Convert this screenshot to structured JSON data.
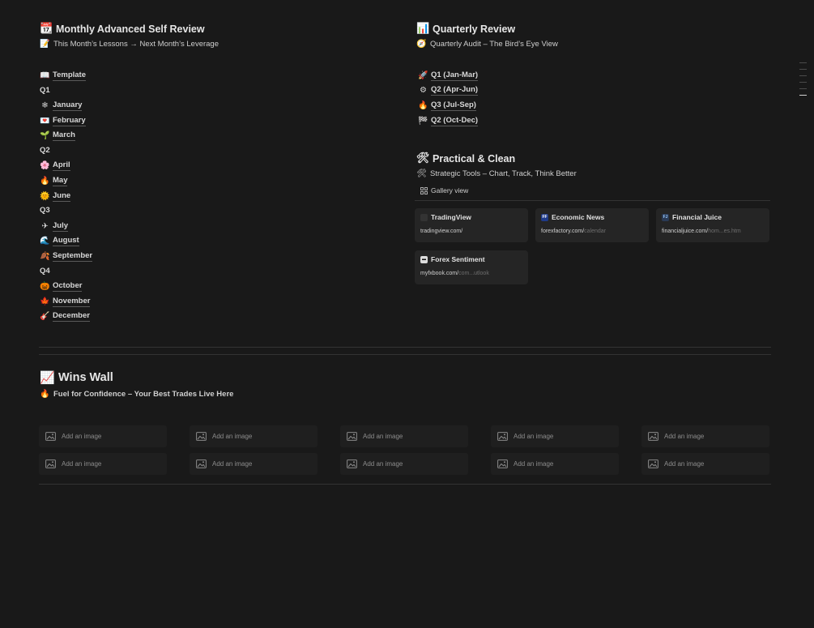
{
  "monthly": {
    "title_icon": "📆",
    "title": "Monthly Advanced Self Review",
    "subtitle_icon": "📝",
    "subtitle": "This Month’s Lessons → Next Month’s Leverage",
    "template_icon": "📖",
    "template": "Template",
    "quarters": [
      {
        "label": "Q1",
        "months": [
          {
            "icon": "❄",
            "name": "January"
          },
          {
            "icon": "💌",
            "name": "February"
          },
          {
            "icon": "🌱",
            "name": "March"
          }
        ]
      },
      {
        "label": "Q2",
        "months": [
          {
            "icon": "🌸",
            "name": "April"
          },
          {
            "icon": "🔥",
            "name": "May"
          },
          {
            "icon": "🌞",
            "name": "June"
          }
        ]
      },
      {
        "label": "Q3",
        "months": [
          {
            "icon": "✈",
            "name": "July"
          },
          {
            "icon": "🌊",
            "name": "August"
          },
          {
            "icon": "🍂",
            "name": "September"
          }
        ]
      },
      {
        "label": "Q4",
        "months": [
          {
            "icon": "🎃",
            "name": "October"
          },
          {
            "icon": "🍁",
            "name": "November"
          },
          {
            "icon": "🎸",
            "name": "December"
          }
        ]
      }
    ]
  },
  "quarterly": {
    "title_icon": "📊",
    "title": "Quarterly Review",
    "subtitle_icon": "🧭",
    "subtitle": "Quarterly Audit – The Bird’s Eye View",
    "items": [
      {
        "icon": "🚀",
        "label": "Q1 (Jan-Mar)"
      },
      {
        "icon": "⚙",
        "label": "Q2 (Apr-Jun)"
      },
      {
        "icon": "🔥",
        "label": "Q3 (Jul-Sep)"
      },
      {
        "icon": "🏁",
        "label": "Q2 (Oct-Dec)"
      }
    ]
  },
  "practical": {
    "title_icon": "🛠",
    "title": "Practical & Clean",
    "subtitle_icon": "🛠",
    "subtitle": "Strategic Tools – Chart, Track, Think Better",
    "view_label": "Gallery view",
    "cards": [
      {
        "icon": "tv",
        "title": "TradingView",
        "url_main": "tradingview.com/",
        "url_dim": ""
      },
      {
        "icon": "ff",
        "title": "Economic News",
        "url_main": "forexfactory.com/",
        "url_dim": "calendar"
      },
      {
        "icon": "fj",
        "title": "Financial Juice",
        "url_main": "financialjuice.com/",
        "url_dim": "hom...es.htm"
      },
      {
        "icon": "fx",
        "title": "Forex Sentiment",
        "url_main": "myfxbook.com/",
        "url_dim": "com...utlook"
      }
    ]
  },
  "wins": {
    "title_icon": "📈",
    "title": "Wins Wall",
    "subtitle_icon": "🔥",
    "subtitle": "Fuel for Confidence – Your Best Trades Live Here",
    "add_image_label": "Add an image"
  },
  "colors": {
    "background": "#191919",
    "card": "#252525",
    "divider": "#333333"
  }
}
